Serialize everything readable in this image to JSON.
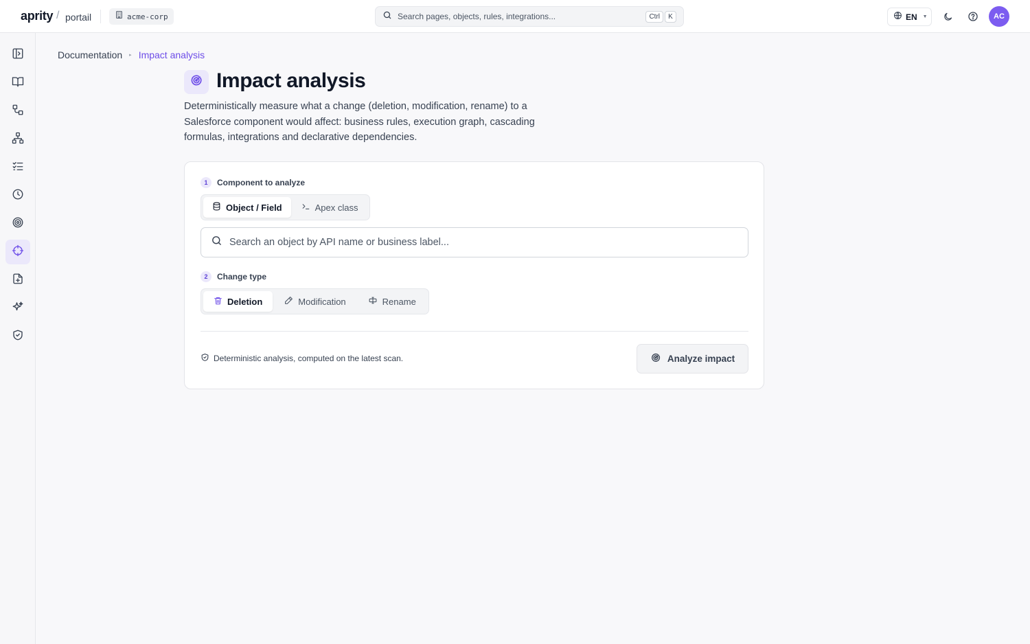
{
  "header": {
    "brand": "aprity",
    "separator": "/",
    "portal": "portail",
    "org": "acme-corp",
    "search_placeholder": "Search pages, objects, rules, integrations...",
    "shortcut_mod": "Ctrl",
    "shortcut_key": "K",
    "language": "EN",
    "avatar_initials": "AC"
  },
  "sidebar": {
    "items": [
      {
        "icon": "sidebar-toggle-icon",
        "active": false
      },
      {
        "icon": "book-icon",
        "active": false
      },
      {
        "icon": "shapes-icon",
        "active": false
      },
      {
        "icon": "network-icon",
        "active": false
      },
      {
        "icon": "checklist-icon",
        "active": false
      },
      {
        "icon": "clock-icon",
        "active": false
      },
      {
        "icon": "target-icon",
        "active": false
      },
      {
        "icon": "crosshair-icon",
        "active": true
      },
      {
        "icon": "file-plus-icon",
        "active": false
      },
      {
        "icon": "sparkles-icon",
        "active": false
      },
      {
        "icon": "shield-check-icon",
        "active": false
      }
    ]
  },
  "breadcrumb": {
    "parent": "Documentation",
    "current": "Impact analysis"
  },
  "page": {
    "title": "Impact analysis",
    "description": "Deterministically measure what a change (deletion, modification, rename) to a Salesforce component would affect: business rules, execution graph, cascading formulas, integrations and declarative dependencies."
  },
  "form": {
    "step1": {
      "number": "1",
      "label": "Component to analyze"
    },
    "component_tabs": [
      {
        "label": "Object / Field",
        "selected": true
      },
      {
        "label": "Apex class",
        "selected": false
      }
    ],
    "search_placeholder": "Search an object by API name or business label...",
    "step2": {
      "number": "2",
      "label": "Change type"
    },
    "change_types": [
      {
        "label": "Deletion",
        "selected": true
      },
      {
        "label": "Modification",
        "selected": false
      },
      {
        "label": "Rename",
        "selected": false
      }
    ],
    "footnote": "Deterministic analysis, computed on the latest scan.",
    "submit_label": "Analyze impact"
  },
  "colors": {
    "accent": "#6d4de8",
    "accent_soft": "#ebe8fb",
    "avatar": "#7c5cf0"
  }
}
